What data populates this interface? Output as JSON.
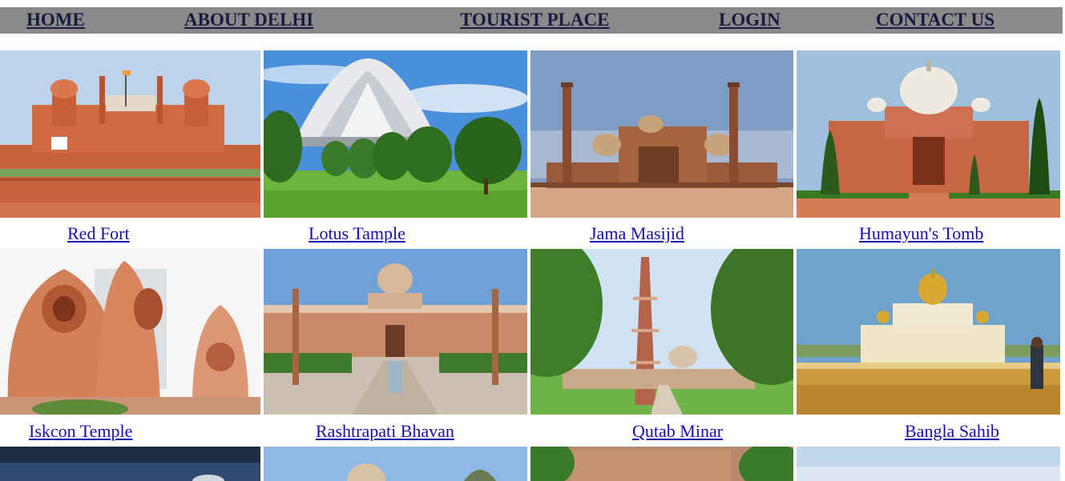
{
  "nav": {
    "home": "HOME",
    "about": "ABOUT DELHI",
    "tourist": "TOURIST PLACE",
    "login": "LOGIN",
    "contact": "CONTACT US"
  },
  "places": [
    {
      "name": "Red Fort",
      "image": "red-fort-image"
    },
    {
      "name": "Lotus Tample",
      "image": "lotus-temple-image"
    },
    {
      "name": "Jama Masijid",
      "image": "jama-masjid-image"
    },
    {
      "name": "Humayun's Tomb",
      "image": "humayuns-tomb-image"
    },
    {
      "name": "Iskcon Temple",
      "image": "iskcon-temple-image"
    },
    {
      "name": "Rashtrapati Bhavan",
      "image": "rashtrapati-bhavan-image"
    },
    {
      "name": "Qutab Minar",
      "image": "qutab-minar-image"
    },
    {
      "name": "Bangla Sahib",
      "image": "bangla-sahib-image"
    }
  ],
  "colors": {
    "nav_bg": "#8a8a8a",
    "nav_text": "#1a1a40",
    "link": "#1a0dab"
  }
}
